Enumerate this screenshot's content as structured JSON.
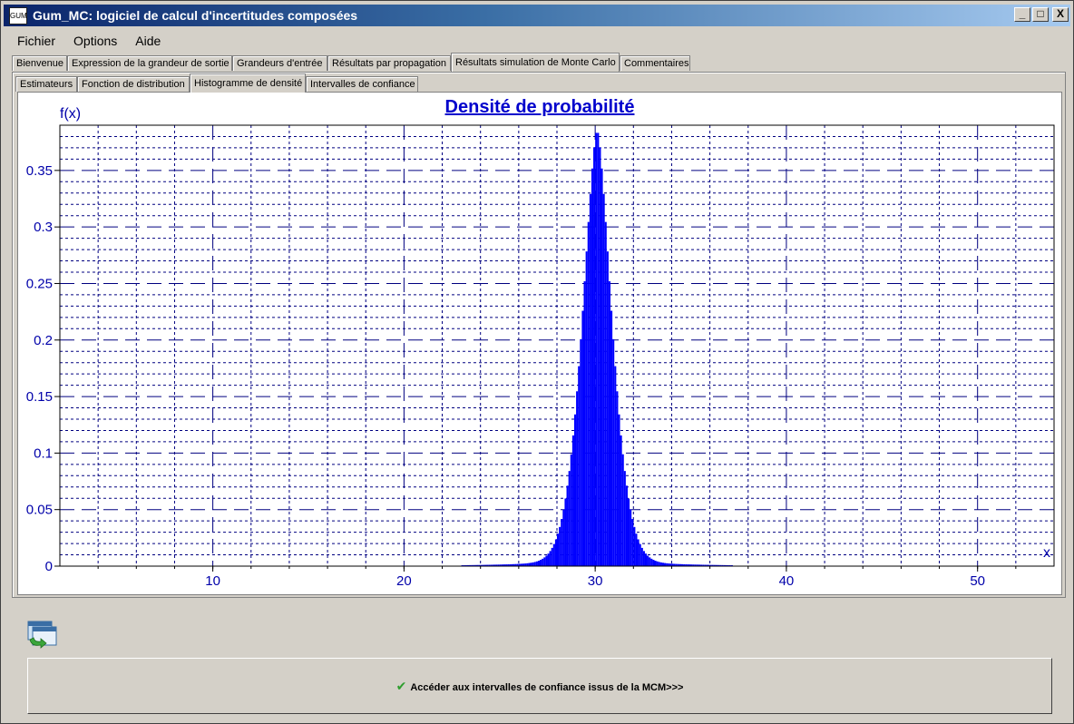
{
  "window": {
    "title": "Gum_MC: logiciel de calcul d'incertitudes composées",
    "app_icon_text": "GUM",
    "controls": [
      "_",
      "□",
      "X"
    ]
  },
  "menu": [
    "Fichier",
    "Options",
    "Aide"
  ],
  "main_tabs": [
    {
      "label": "Bienvenue",
      "active": false
    },
    {
      "label": "Expression de la grandeur de sortie",
      "active": false
    },
    {
      "label": "Grandeurs d'entrée",
      "active": false
    },
    {
      "label": "Résultats par propagation",
      "active": false
    },
    {
      "label": "Résultats simulation de Monte Carlo",
      "active": true
    },
    {
      "label": "Commentaires",
      "active": false
    }
  ],
  "sub_tabs": [
    {
      "label": "Estimateurs",
      "active": false
    },
    {
      "label": "Fonction de distribution",
      "active": false
    },
    {
      "label": "Histogramme de densité",
      "active": true
    },
    {
      "label": "Intervalles de confiance",
      "active": false
    }
  ],
  "chart_data": {
    "type": "bar",
    "title": "Densité de probabilité",
    "xlabel": "x",
    "ylabel": "f(x)",
    "xlim": [
      2,
      54
    ],
    "ylim": [
      0,
      0.39
    ],
    "x_ticks": [
      10,
      20,
      30,
      40,
      50
    ],
    "y_ticks": [
      0,
      0.05,
      0.1,
      0.15,
      0.2,
      0.25,
      0.3,
      0.35
    ],
    "y_tick_labels": [
      "0",
      "0.05",
      "0.1",
      "0.15",
      "0.2",
      "0.25",
      "0.3",
      "0.35"
    ],
    "grid": true,
    "distribution": {
      "shape": "peaked",
      "center": 30.1,
      "peak_density": 0.38,
      "support": [
        16,
        44
      ]
    },
    "color": "#0000ff"
  },
  "action_button": {
    "label": "Accéder aux intervalles de confiance issus de la MCM>>>"
  }
}
